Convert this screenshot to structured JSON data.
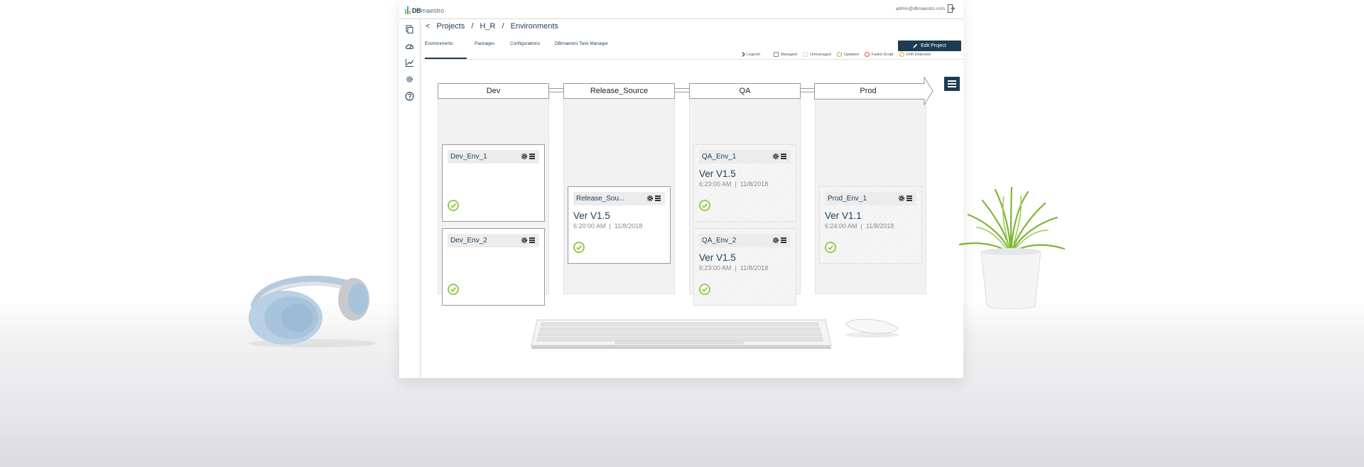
{
  "app": {
    "logo_primary": "DB",
    "logo_secondary": "maestro",
    "user_email": "admin@dbmaestro.com"
  },
  "breadcrumb": {
    "back": "<",
    "items": [
      "Projects",
      "/",
      "H_R",
      "/",
      "Environments"
    ]
  },
  "toolbar": {
    "edit_project_label": "Edit Project"
  },
  "tabs": [
    "Environments",
    "Packages",
    "Configurations",
    "DBmaestro Task Manager"
  ],
  "active_tab": "Environments",
  "legend": {
    "title": "Legend:",
    "managed": "Managed",
    "unmanaged": "Unmanaged",
    "updated": "Updated",
    "failed": "Failed Script",
    "drift": "Drift Detected"
  },
  "colors": {
    "accent": "#1d3b52",
    "updated": "#8cc63f",
    "failed": "#e74c3c",
    "drift": "#f5a623"
  },
  "stages": [
    "Dev",
    "Release_Source",
    "QA",
    "Prod"
  ],
  "environments": {
    "dev_env_1": {
      "name": "Dev_Env_1",
      "status": "updated"
    },
    "dev_env_2": {
      "name": "Dev_Env_2",
      "status": "updated"
    },
    "release_source": {
      "name": "Release_Sou...",
      "version": "Ver V1.5",
      "time": "6:20:00 AM",
      "sep": "|",
      "date": "11/8/2018",
      "status": "updated"
    },
    "qa_env_1": {
      "name": "QA_Env_1",
      "version": "Ver V1.5",
      "time": "6:23:00 AM",
      "sep": "|",
      "date": "11/8/2018",
      "status": "updated"
    },
    "qa_env_2": {
      "name": "QA_Env_2",
      "version": "Ver V1.5",
      "time": "6:23:00 AM",
      "sep": "|",
      "date": "11/8/2018",
      "status": "updated"
    },
    "prod_env_1": {
      "name": "Prod_Env_1",
      "version": "Ver V1.1",
      "time": "6:24:00 AM",
      "sep": "|",
      "date": "11/8/2018",
      "status": "updated"
    }
  },
  "icons": {
    "sidebar": [
      "copy-icon",
      "dashboard-gauge-icon",
      "chart-icon",
      "gear-icon",
      "help-icon"
    ],
    "card_tools": [
      "gear-icon",
      "menu-icon"
    ],
    "status": "check-circle-icon"
  }
}
